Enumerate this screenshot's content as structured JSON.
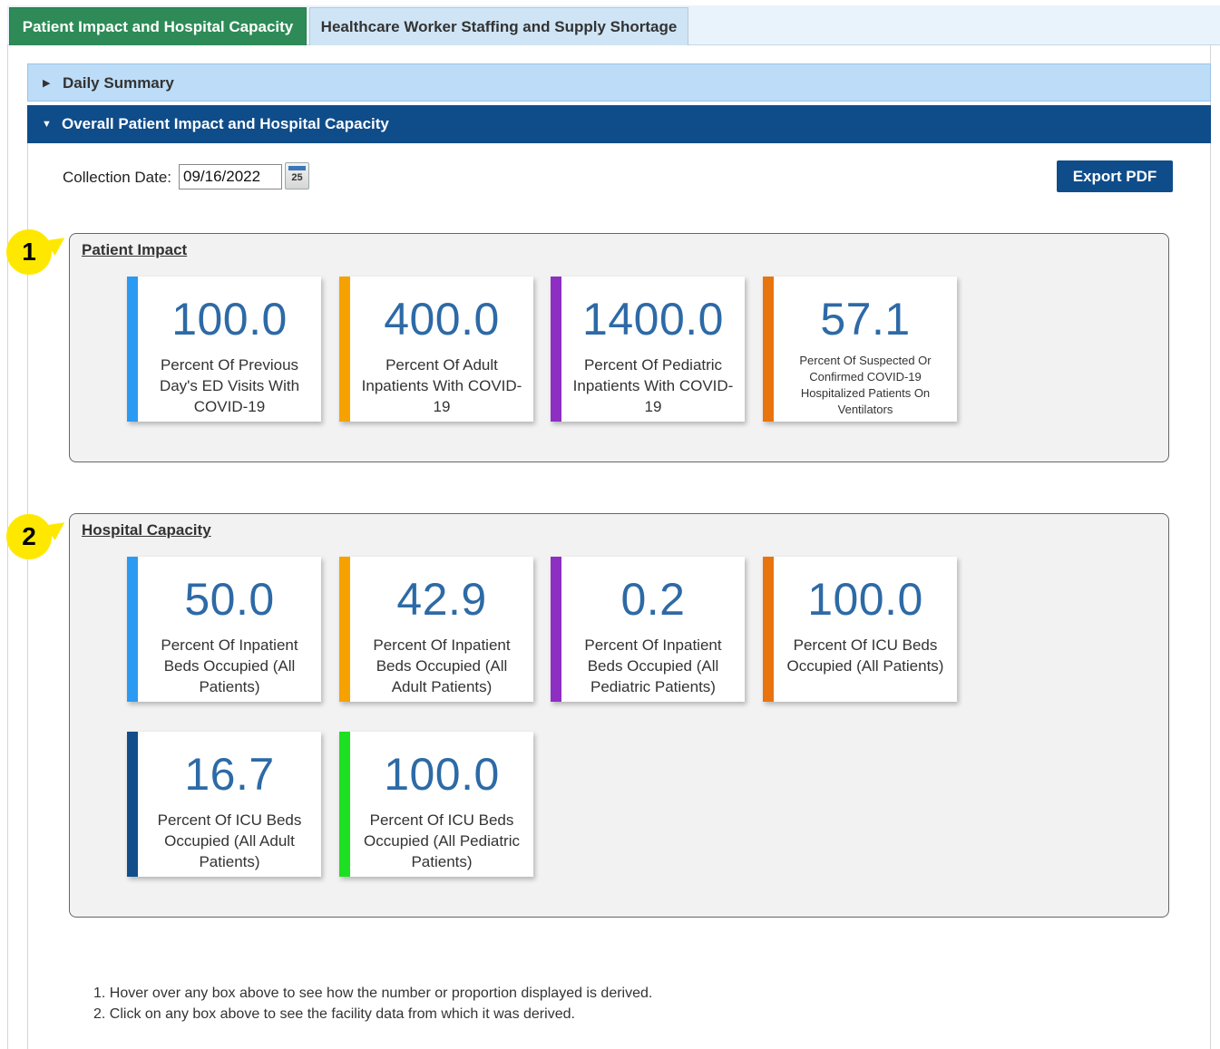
{
  "tabs": [
    {
      "label": "Patient Impact and Hospital Capacity",
      "active": true
    },
    {
      "label": "Healthcare Worker Staffing and Supply Shortage",
      "active": false
    }
  ],
  "accordion": {
    "daily_summary": "Daily Summary",
    "overall": "Overall Patient Impact and Hospital Capacity"
  },
  "collection": {
    "label": "Collection Date:",
    "date": "09/16/2022",
    "calendar_day": "25",
    "calendar_icon": "calendar-icon"
  },
  "export_label": "Export PDF",
  "markers": [
    "1",
    "2"
  ],
  "patient_impact": {
    "title": "Patient Impact",
    "cards": [
      {
        "value": "100.0",
        "label": "Percent Of Previous Day's ED Visits With COVID-19",
        "color": "#2b9af3"
      },
      {
        "value": "400.0",
        "label": "Percent Of Adult Inpatients With COVID-19",
        "color": "#f5a200"
      },
      {
        "value": "1400.0",
        "label": "Percent Of Pediatric Inpatients With COVID-19",
        "color": "#8e2fc4"
      },
      {
        "value": "57.1",
        "label": "Percent Of Suspected Or Confirmed COVID-19 Hospitalized Patients On Ventilators",
        "color": "#e8740f"
      }
    ]
  },
  "hospital_capacity": {
    "title": "Hospital Capacity",
    "cards": [
      {
        "value": "50.0",
        "label": "Percent Of Inpatient Beds Occupied (All Patients)",
        "color": "#2b9af3"
      },
      {
        "value": "42.9",
        "label": "Percent Of Inpatient Beds Occupied (All Adult Patients)",
        "color": "#f5a200"
      },
      {
        "value": "0.2",
        "label": "Percent Of Inpatient Beds Occupied (All Pediatric Patients)",
        "color": "#8e2fc4"
      },
      {
        "value": "100.0",
        "label": "Percent Of ICU Beds Occupied (All Patients)",
        "color": "#e8740f"
      },
      {
        "value": "16.7",
        "label": "Percent Of ICU Beds Occupied (All Adult Patients)",
        "color": "#124e8a"
      },
      {
        "value": "100.0",
        "label": "Percent Of ICU Beds Occupied (All Pediatric Patients)",
        "color": "#1ee022"
      }
    ]
  },
  "notes": [
    "1. Hover over any box above to see how the number or proportion displayed is derived.",
    "2. Click on any box above to see the facility data from which it was derived."
  ]
}
